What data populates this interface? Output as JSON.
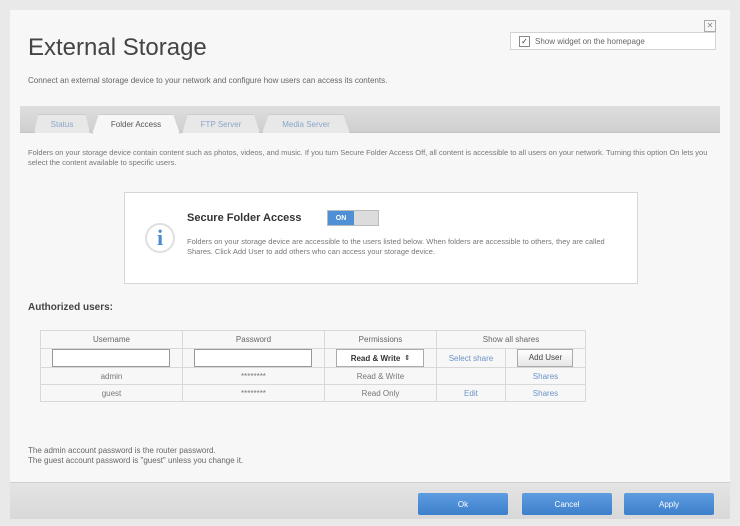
{
  "header": {
    "title": "External Storage",
    "subtitle": "Connect an external storage device to your network and configure how users can access its contents.",
    "widget_label": "Show widget on the homepage",
    "widget_checked": true
  },
  "tabs": [
    {
      "label": "Status",
      "active": false
    },
    {
      "label": "Folder Access",
      "active": true
    },
    {
      "label": "FTP Server",
      "active": false
    },
    {
      "label": "Media Server",
      "active": false
    }
  ],
  "description": "Folders on your storage device contain content such as photos, videos, and music. If you turn Secure Folder Access Off, all content is accessible to all users on your network. Turning this option On lets you select the content available to specific users.",
  "secure": {
    "title": "Secure Folder Access",
    "toggle_state": "ON",
    "text": "Folders on your storage device are accessible to the users listed below. When folders are accessible to others, they are called Shares. Click Add User to add others who can access your storage device."
  },
  "authorized": {
    "title": "Authorized users:",
    "columns": [
      "Username",
      "Password",
      "Permissions",
      "Show all shares"
    ],
    "new_row": {
      "permission": "Read & Write",
      "select_share": "Select share",
      "add_user": "Add User"
    },
    "rows": [
      {
        "username": "admin",
        "password": "********",
        "permission": "Read & Write",
        "edit": "",
        "shares": "Shares"
      },
      {
        "username": "guest",
        "password": "********",
        "permission": "Read Only",
        "edit": "Edit",
        "shares": "Shares"
      }
    ]
  },
  "notes": {
    "line1": "The admin account password is the router password.",
    "line2": "The guest account password is \"guest\" unless you change it."
  },
  "footer": {
    "ok": "Ok",
    "cancel": "Cancel",
    "apply": "Apply"
  }
}
